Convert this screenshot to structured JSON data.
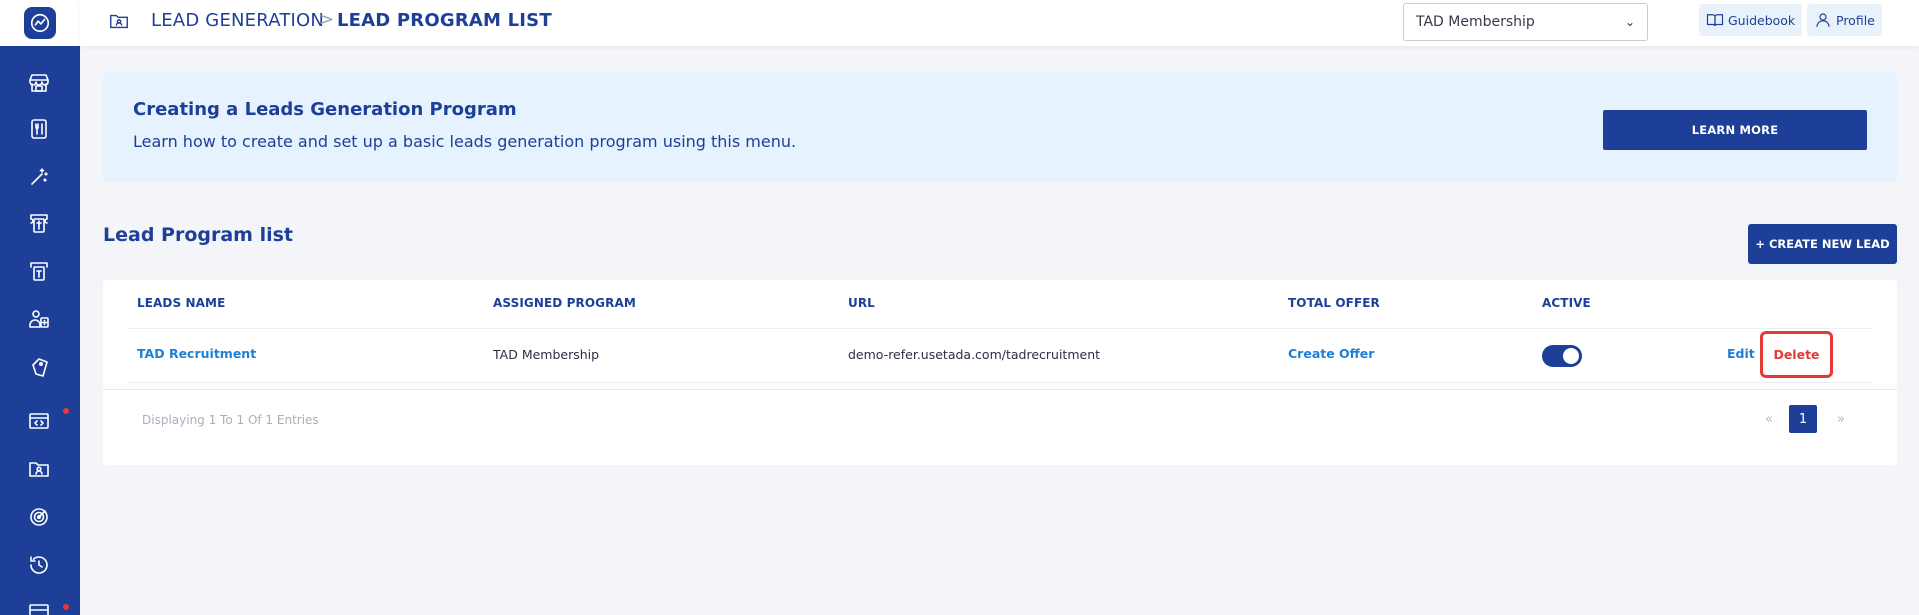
{
  "header": {
    "breadcrumb_parent": "LEAD GENERATION",
    "breadcrumb_separator": ">",
    "breadcrumb_current": "LEAD PROGRAM LIST",
    "program_select_value": "TAD Membership",
    "guidebook_label": "Guidebook",
    "profile_label": "Profile"
  },
  "sidebar": {
    "icons": [
      "store-icon",
      "menu-board-icon",
      "magic-wand-icon",
      "ticket-icon",
      "voucher-icon",
      "user-add-icon",
      "tag-icon",
      "code-window-icon",
      "folder-user-icon",
      "target-icon",
      "history-icon",
      "gift-card-icon"
    ]
  },
  "banner": {
    "title": "Creating a Leads Generation Program",
    "description": "Learn how to create and set up a basic leads generation program using this menu.",
    "button_label": "LEARN MORE"
  },
  "section": {
    "title": "Lead Program list",
    "create_button_label": "+ CREATE NEW LEAD"
  },
  "table": {
    "columns": [
      "LEADS NAME",
      "ASSIGNED PROGRAM",
      "URL",
      "TOTAL OFFER",
      "ACTIVE"
    ],
    "rows": [
      {
        "leads_name": "TAD Recruitment",
        "assigned_program": "TAD Membership",
        "url": "demo-refer.usetada.com/tadrecruitment",
        "total_offer": "Create Offer",
        "active": true,
        "edit_label": "Edit",
        "delete_label": "Delete"
      }
    ],
    "entries_text": "Displaying 1 To 1 Of 1 Entries",
    "pagination": {
      "prev": "«",
      "current": "1",
      "next": "»"
    }
  },
  "colors": {
    "primary": "#1e3f98",
    "link": "#1e7fd6",
    "danger": "#e53935",
    "banner_bg": "#e6f2fd",
    "page_bg": "#f4f5f8"
  }
}
